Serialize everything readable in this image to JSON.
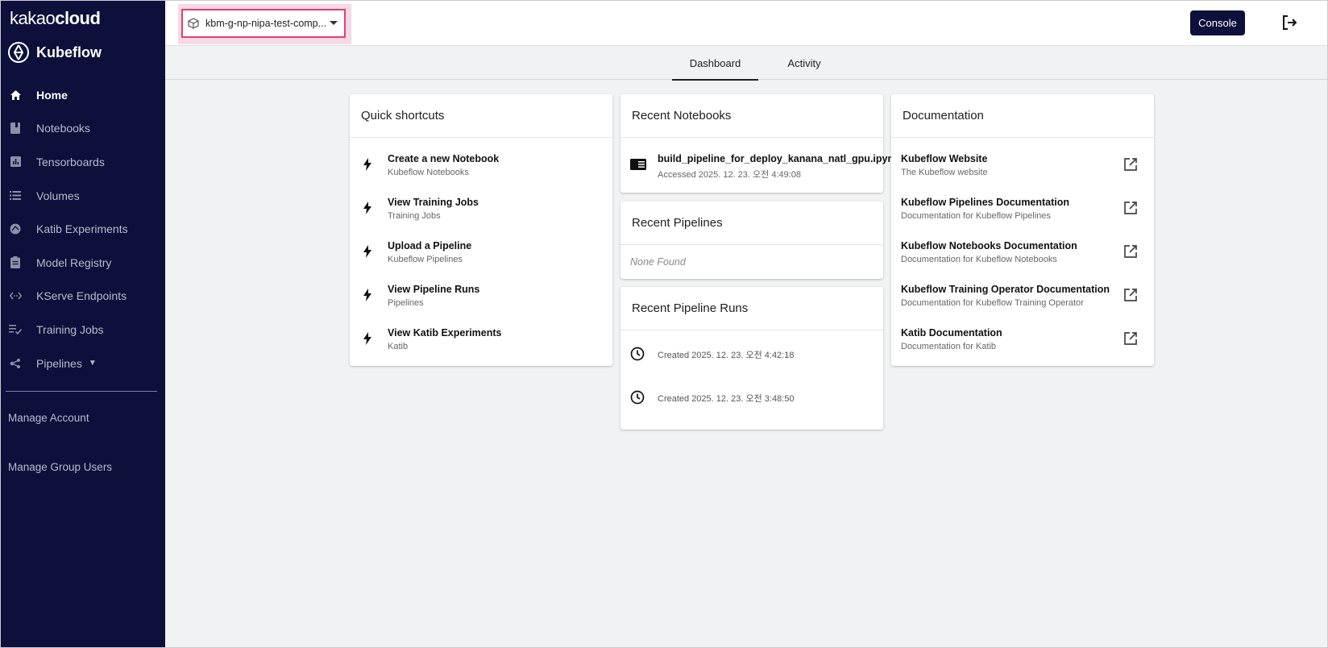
{
  "brand": {
    "kakao": "kakao",
    "cloud": "cloud",
    "product": "Kubeflow"
  },
  "sidebar": {
    "items": [
      {
        "label": "Home",
        "icon": "home-icon",
        "active": true
      },
      {
        "label": "Notebooks",
        "icon": "notebook-icon"
      },
      {
        "label": "Tensorboards",
        "icon": "bar-chart-icon"
      },
      {
        "label": "Volumes",
        "icon": "list-icon"
      },
      {
        "label": "Katib Experiments",
        "icon": "katib-icon"
      },
      {
        "label": "Model Registry",
        "icon": "clipboard-icon"
      },
      {
        "label": "KServe Endpoints",
        "icon": "code-icon"
      },
      {
        "label": "Training Jobs",
        "icon": "playlist-check-icon"
      },
      {
        "label": "Pipelines",
        "icon": "pipeline-icon",
        "has_caret": true
      }
    ],
    "bottom_links": [
      "Manage Account",
      "Manage Group Users"
    ]
  },
  "header": {
    "namespace": "kbm-g-np-nipa-test-comp...",
    "console_label": "Console"
  },
  "tabs": [
    {
      "label": "Dashboard",
      "active": true
    },
    {
      "label": "Activity"
    }
  ],
  "quick_shortcuts": {
    "title": "Quick shortcuts",
    "items": [
      {
        "title": "Create a new Notebook",
        "subtitle": "Kubeflow Notebooks"
      },
      {
        "title": "View Training Jobs",
        "subtitle": "Training Jobs"
      },
      {
        "title": "Upload a Pipeline",
        "subtitle": "Kubeflow Pipelines"
      },
      {
        "title": "View Pipeline Runs",
        "subtitle": "Pipelines"
      },
      {
        "title": "View Katib Experiments",
        "subtitle": "Katib"
      }
    ]
  },
  "recent_notebooks": {
    "title": "Recent Notebooks",
    "items": [
      {
        "title": "build_pipeline_for_deploy_kanana_natl_gpu.ipynb",
        "subtitle": "Accessed 2025. 12. 23. 오전 4:49:08"
      }
    ]
  },
  "recent_pipelines": {
    "title": "Recent Pipelines",
    "empty": "None Found"
  },
  "recent_pipeline_runs": {
    "title": "Recent Pipeline Runs",
    "items": [
      {
        "subtitle": "Created 2025. 12. 23. 오전 4:42:18"
      },
      {
        "subtitle": "Created 2025. 12. 23. 오전 3:48:50"
      }
    ]
  },
  "documentation": {
    "title": "Documentation",
    "items": [
      {
        "title": "Kubeflow Website",
        "subtitle": "The Kubeflow website"
      },
      {
        "title": "Kubeflow Pipelines Documentation",
        "subtitle": "Documentation for Kubeflow Pipelines"
      },
      {
        "title": "Kubeflow Notebooks Documentation",
        "subtitle": "Documentation for Kubeflow Notebooks"
      },
      {
        "title": "Kubeflow Training Operator Documentation",
        "subtitle": "Documentation for Kubeflow Training Operator"
      },
      {
        "title": "Katib Documentation",
        "subtitle": "Documentation for Katib"
      }
    ]
  },
  "colors": {
    "sidebar_bg": "#0c103a",
    "accent_pink": "#e23e7a",
    "page_bg": "#f1f2f4"
  }
}
